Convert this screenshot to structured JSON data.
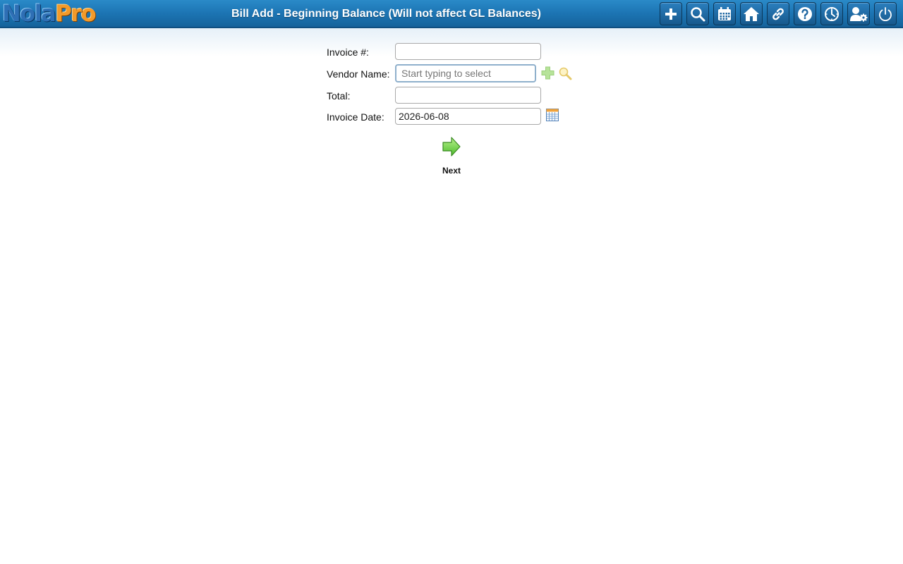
{
  "header": {
    "logo_part1": "Nola",
    "logo_part2": "Pro",
    "title": "Bill Add - Beginning Balance (Will not affect GL Balances)"
  },
  "toolbar": {
    "buttons": [
      {
        "icon": "plus-icon"
      },
      {
        "icon": "search-icon"
      },
      {
        "icon": "calendar-icon"
      },
      {
        "icon": "home-icon"
      },
      {
        "icon": "link-icon"
      },
      {
        "icon": "help-icon"
      },
      {
        "icon": "clock-icon"
      },
      {
        "icon": "user-settings-icon"
      },
      {
        "icon": "power-icon"
      }
    ]
  },
  "form": {
    "invoice_number": {
      "label": "Invoice #:",
      "value": ""
    },
    "vendor_name": {
      "label": "Vendor Name:",
      "value": "",
      "placeholder": "Start typing to select"
    },
    "total": {
      "label": "Total:",
      "value": ""
    },
    "invoice_date": {
      "label": "Invoice Date:",
      "value": "2026-06-08"
    },
    "next_label": "Next"
  },
  "colors": {
    "header_blue": "#1c74b3",
    "logo_blue": "#2e6fb5",
    "logo_orange": "#f39a2a",
    "next_arrow_green": "#7ed957"
  }
}
